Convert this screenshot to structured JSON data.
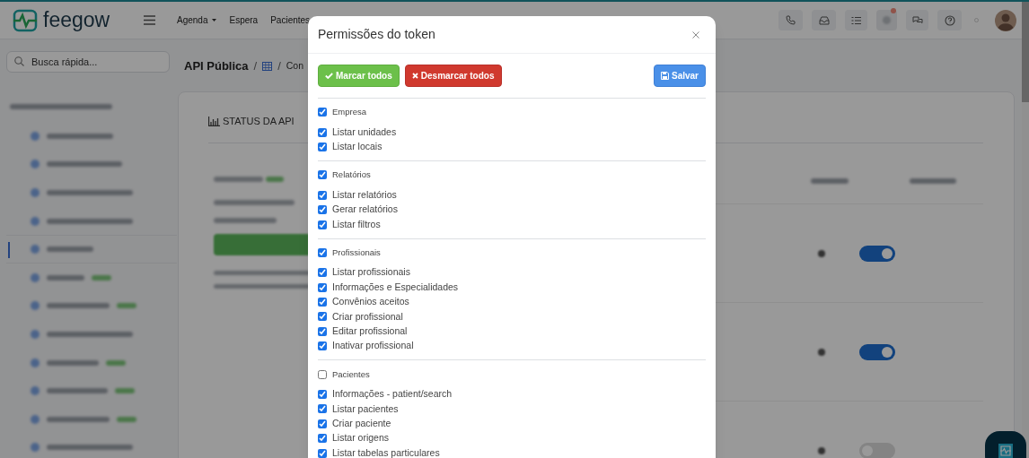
{
  "header": {
    "logo": "feegow",
    "nav": [
      {
        "label": "Agenda",
        "dropdown": true
      },
      {
        "label": "Espera",
        "dropdown": false
      },
      {
        "label": "Pacientes",
        "dropdown": false
      }
    ],
    "notification_badge": true
  },
  "sidebar": {
    "search": {
      "placeholder": "Busca rápida..."
    },
    "items": [
      {
        "selected": false,
        "badge": false
      },
      {
        "selected": false,
        "badge": false
      },
      {
        "selected": false,
        "badge": false
      },
      {
        "selected": false,
        "badge": false
      },
      {
        "selected": true,
        "badge": false
      },
      {
        "selected": false,
        "badge": true
      },
      {
        "selected": false,
        "badge": true
      },
      {
        "selected": false,
        "badge": false
      },
      {
        "selected": false,
        "badge": true
      },
      {
        "selected": false,
        "badge": true
      },
      {
        "selected": false,
        "badge": true
      },
      {
        "selected": false,
        "badge": false
      }
    ]
  },
  "breadcrumb": {
    "title": "API Pública",
    "separators": [
      "/",
      "/"
    ],
    "current": "Con"
  },
  "card": {
    "title": "STATUS DA API",
    "toggles": [
      {
        "on": true
      },
      {
        "on": true
      },
      {
        "on": false
      }
    ]
  },
  "modal": {
    "title": "Permissões do token",
    "buttons": [
      {
        "kind": "check_all",
        "label": "Marcar todos"
      },
      {
        "kind": "uncheck_all",
        "label": "Desmarcar todos"
      },
      {
        "kind": "save",
        "label": "Salvar"
      }
    ],
    "groups": [
      {
        "label": "Empresa",
        "checked": true,
        "children": [
          {
            "label": "Listar unidades",
            "checked": true
          },
          {
            "label": "Listar locais",
            "checked": true
          }
        ]
      },
      {
        "label": "Relatórios",
        "checked": true,
        "children": [
          {
            "label": "Listar relatórios",
            "checked": true
          },
          {
            "label": "Gerar relatórios",
            "checked": true
          },
          {
            "label": "Listar filtros",
            "checked": true
          }
        ]
      },
      {
        "label": "Profissionais",
        "checked": true,
        "children": [
          {
            "label": "Listar profissionais",
            "checked": true
          },
          {
            "label": "Informações e Especialidades",
            "checked": true
          },
          {
            "label": "Convênios aceitos",
            "checked": true
          },
          {
            "label": "Criar profissional",
            "checked": true
          },
          {
            "label": "Editar profissional",
            "checked": true
          },
          {
            "label": "Inativar profissional",
            "checked": true
          }
        ]
      },
      {
        "label": "Pacientes",
        "checked": false,
        "children": [
          {
            "label": "Informações - patient/search",
            "checked": true
          },
          {
            "label": "Listar pacientes",
            "checked": true
          },
          {
            "label": "Criar paciente",
            "checked": true
          },
          {
            "label": "Listar origens",
            "checked": true
          },
          {
            "label": "Listar tabelas particulares",
            "checked": true
          }
        ]
      }
    ]
  }
}
